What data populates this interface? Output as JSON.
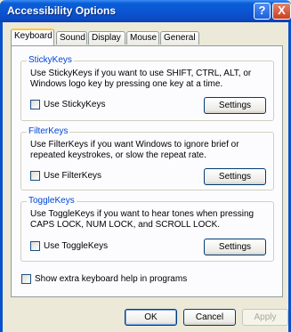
{
  "window": {
    "title": "Accessibility Options",
    "help_glyph": "?",
    "close_glyph": "X"
  },
  "tabs": [
    {
      "label": "Keyboard",
      "active": true
    },
    {
      "label": "Sound"
    },
    {
      "label": "Display"
    },
    {
      "label": "Mouse"
    },
    {
      "label": "General"
    }
  ],
  "stickykeys": {
    "group_label": "StickyKeys",
    "description": "Use StickyKeys if you want to use SHIFT, CTRL, ALT, or Windows logo key by pressing one key at a time.",
    "checkbox_label": "Use StickyKeys",
    "settings_label": "Settings"
  },
  "filterkeys": {
    "group_label": "FilterKeys",
    "description": "Use FilterKeys if you want Windows to ignore brief or repeated keystrokes, or slow the repeat rate.",
    "checkbox_label": "Use FilterKeys",
    "settings_label": "Settings"
  },
  "togglekeys": {
    "group_label": "ToggleKeys",
    "description": "Use ToggleKeys if you want to hear tones when pressing CAPS LOCK, NUM LOCK, and SCROLL LOCK.",
    "checkbox_label": "Use ToggleKeys",
    "settings_label": "Settings"
  },
  "extra_help": {
    "checkbox_label": "Show extra keyboard help in programs"
  },
  "buttons": {
    "ok": "OK",
    "cancel": "Cancel",
    "apply": "Apply"
  },
  "colors": {
    "titlebar": "#0a54d0",
    "group_label": "#0046d5",
    "dialog_bg": "#ece9d8"
  }
}
